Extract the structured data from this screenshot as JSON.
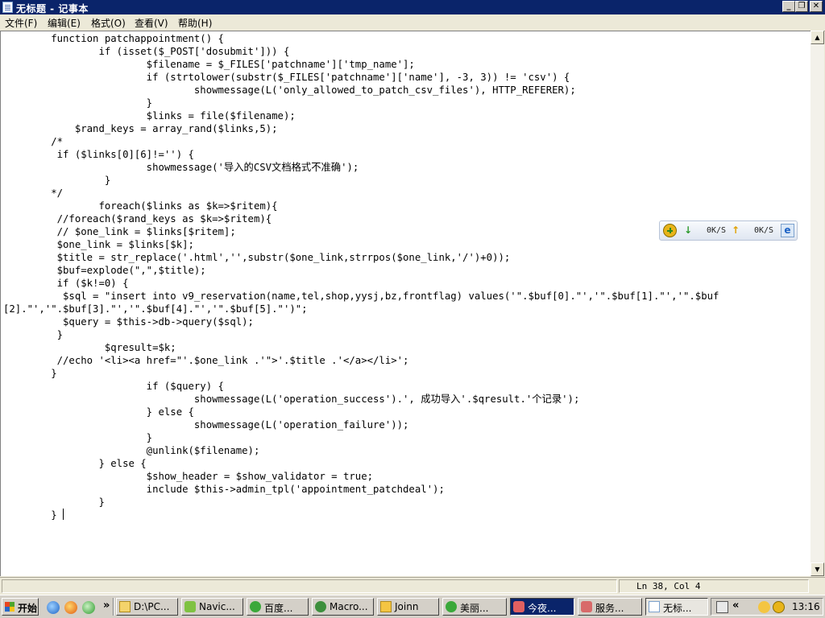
{
  "window": {
    "title": "无标题 - 记事本",
    "min_glyph": "_",
    "max_glyph": "❐",
    "close_glyph": "✕"
  },
  "menu": [
    {
      "label": "文件(F)"
    },
    {
      "label": "编辑(E)"
    },
    {
      "label": "格式(O)"
    },
    {
      "label": "查看(V)"
    },
    {
      "label": "帮助(H)"
    }
  ],
  "editor": {
    "content": "        function patchappointment() {\n                if (isset($_POST['dosubmit'])) {\n                        $filename = $_FILES['patchname']['tmp_name'];\n                        if (strtolower(substr($_FILES['patchname']['name'], -3, 3)) != 'csv') {\n                                showmessage(L('only_allowed_to_patch_csv_files'), HTTP_REFERER);\n                        }\n                        $links = file($filename);\n            $rand_keys = array_rand($links,5);\n        /*\n         if ($links[0][6]!='') {\n                        showmessage('导入的CSV文档格式不准确');\n                 }\n        */\n                foreach($links as $k=>$ritem){\n         //foreach($rand_keys as $k=>$ritem){\n         // $one_link = $links[$ritem];\n         $one_link = $links[$k];\n         $title = str_replace('.html','',substr($one_link,strrpos($one_link,'/')+0));\n         $buf=explode(\",\",$title);\n         if ($k!=0) {\n          $sql = \"insert into v9_reservation(name,tel,shop,yysj,bz,frontflag) values('\".$buf[0].\"','\".$buf[1].\"','\".$buf\n[2].\"','\".$buf[3].\"','\".$buf[4].\"','\".$buf[5].\"')\";\n          $query = $this->db->query($sql);\n         }\n                 $qresult=$k;\n         //echo '<li><a href=\"'.$one_link .'\">'.$title .'</a></li>';\n        }\n                        if ($query) {\n                                showmessage(L('operation_success').', 成功导入'.$qresult.'个记录');\n                        } else {\n                                showmessage(L('operation_failure'));\n                        }\n                        @unlink($filename);\n                } else {\n                        $show_header = $show_validator = true;\n                        include $this->admin_tpl('appointment_patchdeal');\n                }\n        } "
  },
  "statusbar": {
    "position": "Ln 38, Col 4"
  },
  "net_widget": {
    "down_speed": "0K/S",
    "up_speed": "0K/S",
    "down_icon": "down-arrow-icon",
    "up_icon": "up-arrow-icon"
  },
  "taskbar": {
    "start_label": "开始",
    "more_glyph": "»",
    "tasks": [
      {
        "label": "D:\\PC...",
        "icon": "folder-icon"
      },
      {
        "label": "Navic...",
        "icon": "navicat-icon"
      },
      {
        "label": "百度...",
        "icon": "browser-icon"
      },
      {
        "label": "Macro...",
        "icon": "dreamweaver-icon"
      },
      {
        "label": "Joinn",
        "icon": "folder-icon"
      },
      {
        "label": "美丽...",
        "icon": "browser-icon"
      },
      {
        "label": "今夜...",
        "icon": "chat-icon"
      },
      {
        "label": "服务...",
        "icon": "chat-icon"
      },
      {
        "label": "无标...",
        "icon": "notepad-icon"
      }
    ],
    "tray_collapse_glyph": "«",
    "clock": "13:16"
  },
  "colors": {
    "title_bar": "#0a246a",
    "window_face": "#ece9d8",
    "editor_bg": "#ffffff",
    "active_task": "#e8e6e0"
  }
}
